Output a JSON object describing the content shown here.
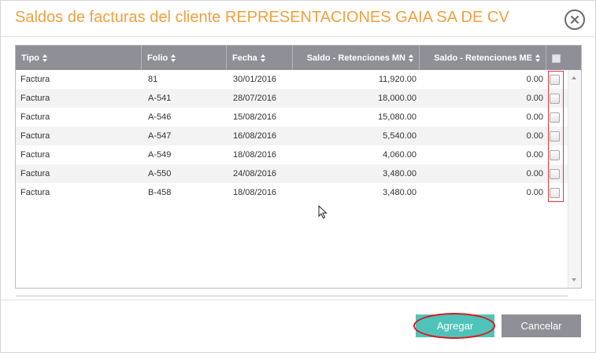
{
  "dialog": {
    "title": "Saldos de facturas del cliente REPRESENTACIONES GAIA SA DE CV",
    "close_icon": "close-icon"
  },
  "table": {
    "columns": [
      "Tipo",
      "Folio",
      "Fecha",
      "Saldo - Retenciones MN",
      "Saldo - Retenciones ME"
    ],
    "rows": [
      {
        "tipo": "Factura",
        "folio": "81",
        "fecha": "30/01/2016",
        "mn": "11,920.00",
        "me": "0.00",
        "checked": false
      },
      {
        "tipo": "Factura",
        "folio": "A-541",
        "fecha": "28/07/2016",
        "mn": "18,000.00",
        "me": "0.00",
        "checked": false
      },
      {
        "tipo": "Factura",
        "folio": "A-546",
        "fecha": "15/08/2016",
        "mn": "15,080.00",
        "me": "0.00",
        "checked": false
      },
      {
        "tipo": "Factura",
        "folio": "A-547",
        "fecha": "16/08/2016",
        "mn": "5,540.00",
        "me": "0.00",
        "checked": false
      },
      {
        "tipo": "Factura",
        "folio": "A-549",
        "fecha": "18/08/2016",
        "mn": "4,060.00",
        "me": "0.00",
        "checked": false
      },
      {
        "tipo": "Factura",
        "folio": "A-550",
        "fecha": "24/08/2016",
        "mn": "3,480.00",
        "me": "0.00",
        "checked": false
      },
      {
        "tipo": "Factura",
        "folio": "B-458",
        "fecha": "18/08/2016",
        "mn": "3,480.00",
        "me": "0.00",
        "checked": false
      }
    ]
  },
  "footer": {
    "agregar_label": "Agregar",
    "cancelar_label": "Cancelar"
  },
  "colors": {
    "title": "#f0a040",
    "header_bg": "#8f8f97",
    "primary_button": "#4fc3b9",
    "secondary_button": "#8f8f97",
    "highlight": "#e0141e"
  }
}
